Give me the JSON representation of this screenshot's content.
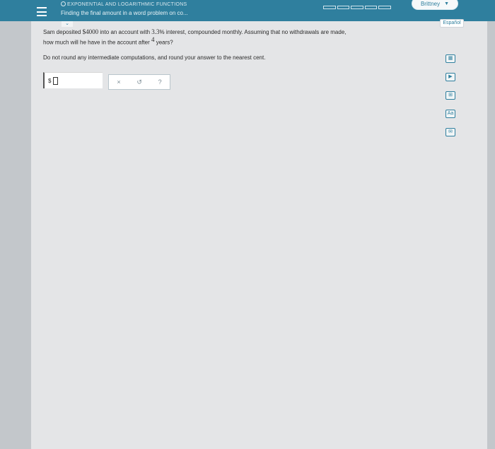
{
  "header": {
    "topic": "EXPONENTIAL AND LOGARITHMIC FUNCTIONS",
    "lesson": "Finding the final amount in a word problem on co...",
    "user_name": "Brittney",
    "progress_segments": 5,
    "accent_color": "#2f7f9e"
  },
  "language_button": "Español",
  "collapse_icon": "chevron-down-icon",
  "question": {
    "part1": "Sam deposited ",
    "principal": "$4000",
    "part2": " into an account with ",
    "rate": "3.3",
    "part3": "% interest, compounded monthly. Assuming that no withdrawals are made,",
    "part4": "how much will he have in the account after ",
    "years": "4",
    "part5": " years?"
  },
  "instruction": "Do not round any intermediate computations, and round your answer to the nearest cent.",
  "answer": {
    "prefix": "$",
    "value": ""
  },
  "tools": {
    "clear": "×",
    "undo": "↺",
    "help": "?"
  },
  "side_tools": [
    {
      "icon": "calculator-icon",
      "glyph": "▦"
    },
    {
      "icon": "video-icon",
      "glyph": "▶"
    },
    {
      "icon": "data-table-icon",
      "glyph": "⊞"
    },
    {
      "icon": "textbook-icon",
      "glyph": "Aa"
    },
    {
      "icon": "message-icon",
      "glyph": "✉"
    }
  ]
}
